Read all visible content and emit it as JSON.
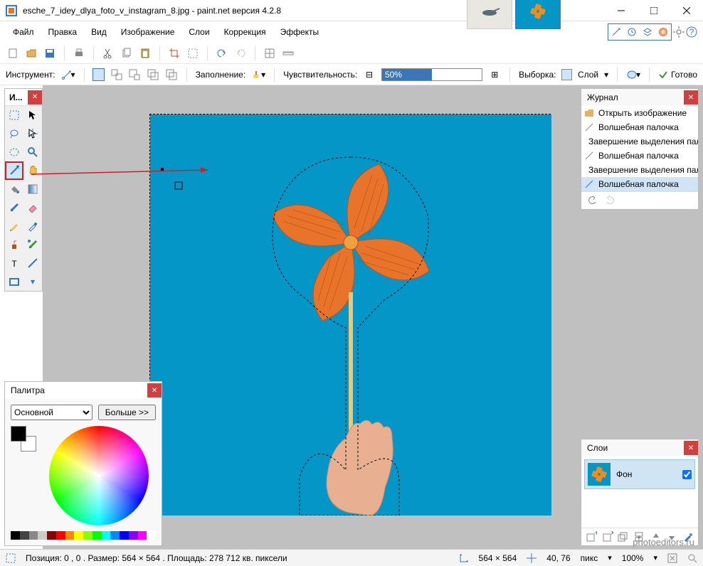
{
  "titlebar": {
    "filename": "esche_7_idey_dlya_foto_v_instagram_8.jpg - paint.net версия 4.2.8"
  },
  "menu": {
    "file": "Файл",
    "edit": "Правка",
    "view": "Вид",
    "image": "Изображение",
    "layers": "Слои",
    "adjustments": "Коррекция",
    "effects": "Эффекты"
  },
  "toolbar2": {
    "tool_label": "Инструмент:",
    "fill_label": "Заполнение:",
    "tolerance_label": "Чувствительность:",
    "tolerance_value": "50%",
    "selection_label": "Выборка:",
    "layer_label": "Слой",
    "ready_label": "Готово"
  },
  "tools_panel": {
    "title": "И..."
  },
  "history": {
    "title": "Журнал",
    "items": [
      "Открыть изображение",
      "Волшебная палочка",
      "Завершение выделения палочкой",
      "Волшебная палочка",
      "Завершение выделения палочкой",
      "Волшебная палочка"
    ]
  },
  "palette": {
    "title": "Палитра",
    "primary_label": "Основной",
    "more_label": "Больше >>"
  },
  "layers": {
    "title": "Слои",
    "background_label": "Фон"
  },
  "statusbar": {
    "position": "Позиция: 0 , 0 . Размер: 564  × 564 . Площадь: 278 712 кв. пиксели",
    "dimensions": "564 × 564",
    "cursor": "40, 76",
    "unit": "пикс",
    "zoom": "100%"
  },
  "watermark": "photoeditors.ru",
  "colors": {
    "accent": "#3a76b8",
    "canvas_blue": "#0496c7",
    "orange": "#e8732a"
  }
}
